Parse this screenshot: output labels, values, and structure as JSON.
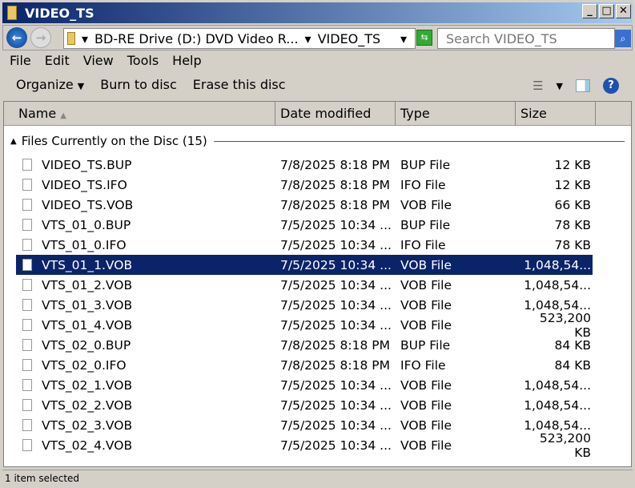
{
  "window": {
    "title": "VIDEO_TS"
  },
  "address": {
    "crumbs": [
      "BD-RE Drive (D:) DVD Video R...",
      "VIDEO_TS"
    ],
    "search_placeholder": "Search VIDEO_TS"
  },
  "menu": [
    "File",
    "Edit",
    "View",
    "Tools",
    "Help"
  ],
  "toolbar": {
    "organize": "Organize",
    "burn": "Burn to disc",
    "erase": "Erase this disc"
  },
  "columns": [
    "Name",
    "Date modified",
    "Type",
    "Size"
  ],
  "group": "Files Currently on the Disc (15)",
  "files": [
    {
      "name": "VIDEO_TS.BUP",
      "date": "7/8/2025 8:18 PM",
      "type": "BUP File",
      "size": "12 KB"
    },
    {
      "name": "VIDEO_TS.IFO",
      "date": "7/8/2025 8:18 PM",
      "type": "IFO File",
      "size": "12 KB"
    },
    {
      "name": "VIDEO_TS.VOB",
      "date": "7/8/2025 8:18 PM",
      "type": "VOB File",
      "size": "66 KB"
    },
    {
      "name": "VTS_01_0.BUP",
      "date": "7/5/2025 10:34 ...",
      "type": "BUP File",
      "size": "78 KB"
    },
    {
      "name": "VTS_01_0.IFO",
      "date": "7/5/2025 10:34 ...",
      "type": "IFO File",
      "size": "78 KB"
    },
    {
      "name": "VTS_01_1.VOB",
      "date": "7/5/2025 10:34 ...",
      "type": "VOB File",
      "size": "1,048,54..."
    },
    {
      "name": "VTS_01_2.VOB",
      "date": "7/5/2025 10:34 ...",
      "type": "VOB File",
      "size": "1,048,54..."
    },
    {
      "name": "VTS_01_3.VOB",
      "date": "7/5/2025 10:34 ...",
      "type": "VOB File",
      "size": "1,048,54..."
    },
    {
      "name": "VTS_01_4.VOB",
      "date": "7/5/2025 10:34 ...",
      "type": "VOB File",
      "size": "523,200 KB"
    },
    {
      "name": "VTS_02_0.BUP",
      "date": "7/8/2025 8:18 PM",
      "type": "BUP File",
      "size": "84 KB"
    },
    {
      "name": "VTS_02_0.IFO",
      "date": "7/8/2025 8:18 PM",
      "type": "IFO File",
      "size": "84 KB"
    },
    {
      "name": "VTS_02_1.VOB",
      "date": "7/5/2025 10:34 ...",
      "type": "VOB File",
      "size": "1,048,54..."
    },
    {
      "name": "VTS_02_2.VOB",
      "date": "7/5/2025 10:34 ...",
      "type": "VOB File",
      "size": "1,048,54..."
    },
    {
      "name": "VTS_02_3.VOB",
      "date": "7/5/2025 10:34 ...",
      "type": "VOB File",
      "size": "1,048,54..."
    },
    {
      "name": "VTS_02_4.VOB",
      "date": "7/5/2025 10:34 ...",
      "type": "VOB File",
      "size": "523,200 KB"
    }
  ],
  "status": "1 item selected"
}
